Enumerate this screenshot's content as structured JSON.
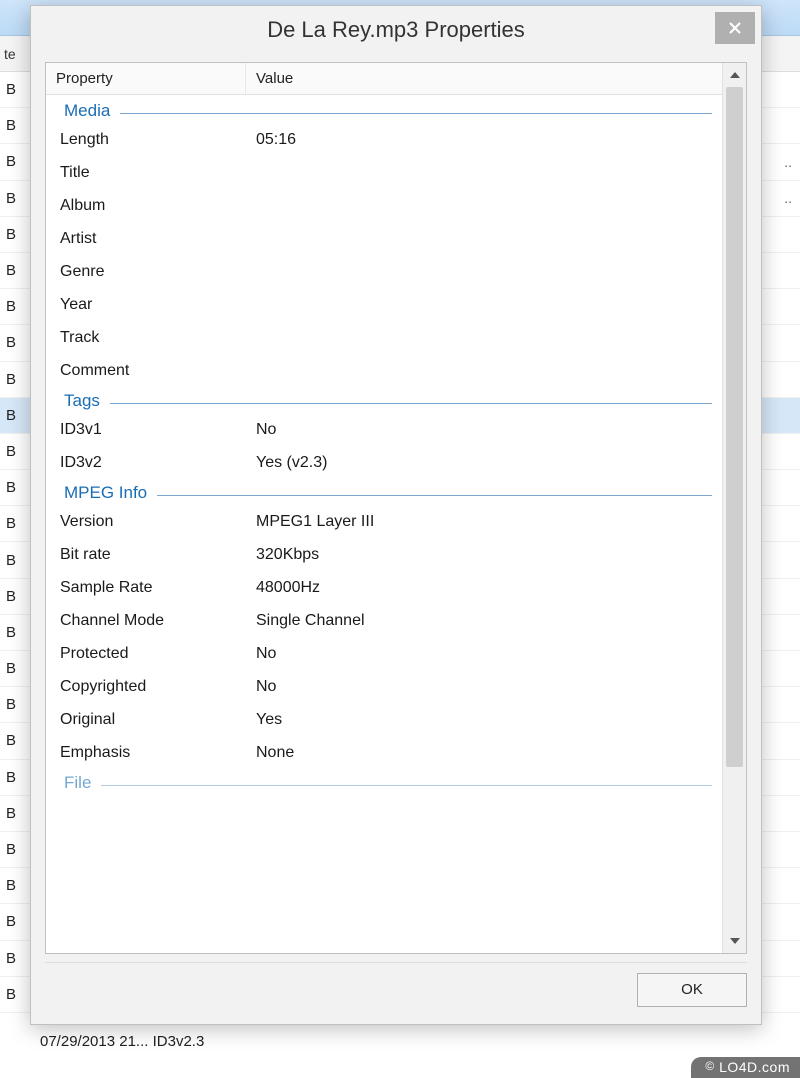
{
  "dialog": {
    "title": "De La Rey.mp3 Properties",
    "headers": {
      "property": "Property",
      "value": "Value"
    },
    "sections": [
      {
        "label": "Media",
        "rows": [
          {
            "property": "Length",
            "value": "05:16"
          },
          {
            "property": "Title",
            "value": ""
          },
          {
            "property": "Album",
            "value": ""
          },
          {
            "property": "Artist",
            "value": ""
          },
          {
            "property": "Genre",
            "value": ""
          },
          {
            "property": "Year",
            "value": ""
          },
          {
            "property": "Track",
            "value": ""
          },
          {
            "property": "Comment",
            "value": ""
          }
        ]
      },
      {
        "label": "Tags",
        "rows": [
          {
            "property": "ID3v1",
            "value": "No"
          },
          {
            "property": "ID3v2",
            "value": "Yes (v2.3)"
          }
        ]
      },
      {
        "label": "MPEG Info",
        "rows": [
          {
            "property": "Version",
            "value": "MPEG1 Layer III"
          },
          {
            "property": "Bit rate",
            "value": "320Kbps"
          },
          {
            "property": "Sample Rate",
            "value": "48000Hz"
          },
          {
            "property": "Channel Mode",
            "value": "Single Channel"
          },
          {
            "property": "Protected",
            "value": "No"
          },
          {
            "property": "Copyrighted",
            "value": "No"
          },
          {
            "property": "Original",
            "value": "Yes"
          },
          {
            "property": "Emphasis",
            "value": "None"
          }
        ]
      },
      {
        "label": "File",
        "partial": true,
        "rows": []
      }
    ],
    "ok_label": "OK"
  },
  "background": {
    "toolbar_text": "te",
    "row_text": "B",
    "row_right_dots": "..",
    "selected_index": 9,
    "bottom_text": "07/29/2013 21...   ID3v2.3"
  },
  "watermark": {
    "text": "LO4D.com"
  }
}
